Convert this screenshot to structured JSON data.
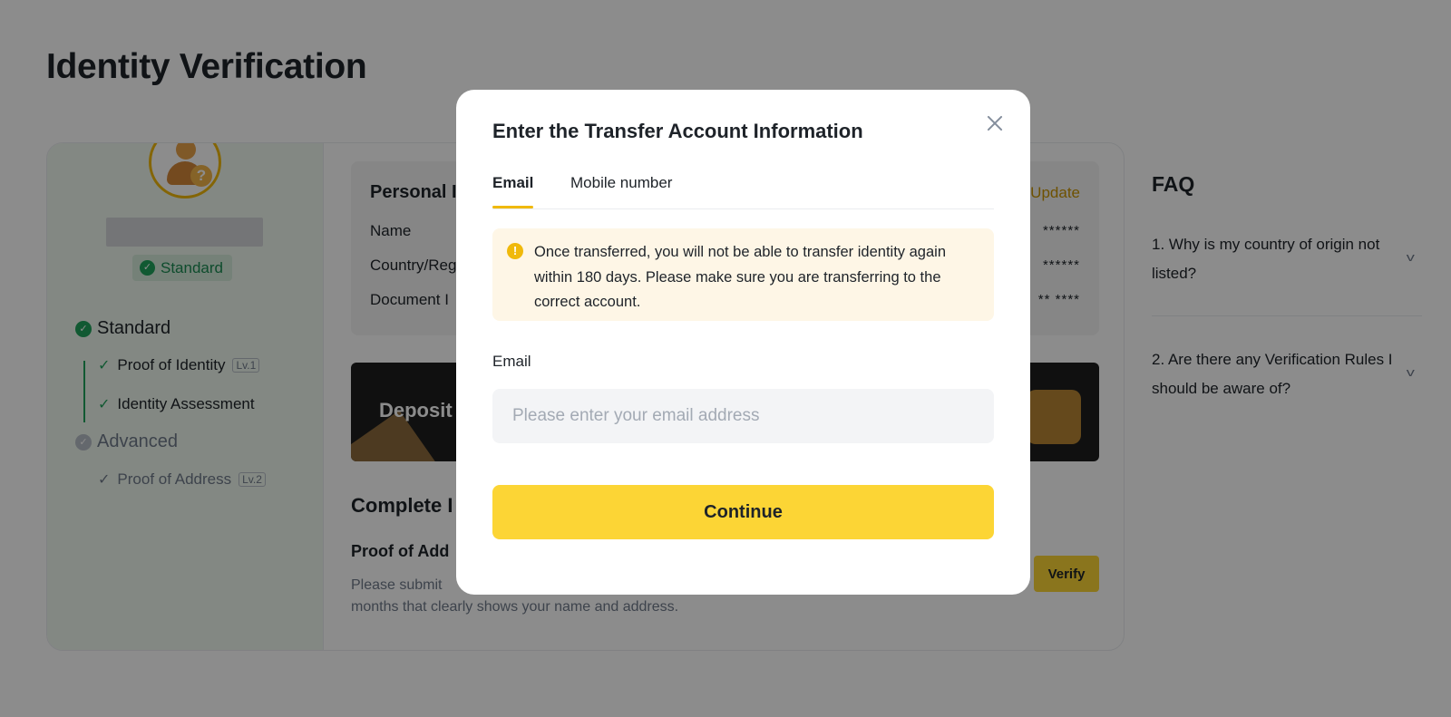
{
  "page": {
    "title": "Identity Verification"
  },
  "profile": {
    "level_badge": "Standard"
  },
  "steps": {
    "standard": "Standard",
    "proof_of_identity": "Proof of Identity",
    "proof_of_identity_tag": "Lv.1",
    "identity_assessment": "Identity Assessment",
    "advanced": "Advanced",
    "proof_of_address": "Proof of Address",
    "proof_of_address_tag": "Lv.2"
  },
  "personal": {
    "title": "Personal I",
    "update": "Update",
    "rows": [
      {
        "label": "Name",
        "value": "******"
      },
      {
        "label": "Country/Reg",
        "value": "******"
      },
      {
        "label": "Document I",
        "value": "** ****"
      }
    ]
  },
  "banner": {
    "text": "Deposit"
  },
  "complete": {
    "title": "Complete I",
    "proof_title": "Proof of Add",
    "proof_desc_line1": "Please submit",
    "proof_desc_line2": "months that clearly shows your name and address.",
    "verify": "Verify"
  },
  "faq": {
    "title": "FAQ",
    "items": [
      "1. Why is my country of origin not listed?",
      "2. Are there any Verification Rules I should be aware of?"
    ]
  },
  "modal": {
    "title": "Enter the Transfer Account Information",
    "tabs": [
      "Email",
      "Mobile number"
    ],
    "active_tab": "Email",
    "warning": "Once transferred, you will not be able to transfer identity again within 180 days. Please make sure you are transferring to the correct account.",
    "field_label": "Email",
    "email_value": "",
    "email_placeholder": "Please enter your email address",
    "continue": "Continue"
  },
  "colors": {
    "accent": "#fcd535",
    "tab_underline": "#f0b90b",
    "success": "#20a35c",
    "warning_bg": "#fef6e6"
  }
}
